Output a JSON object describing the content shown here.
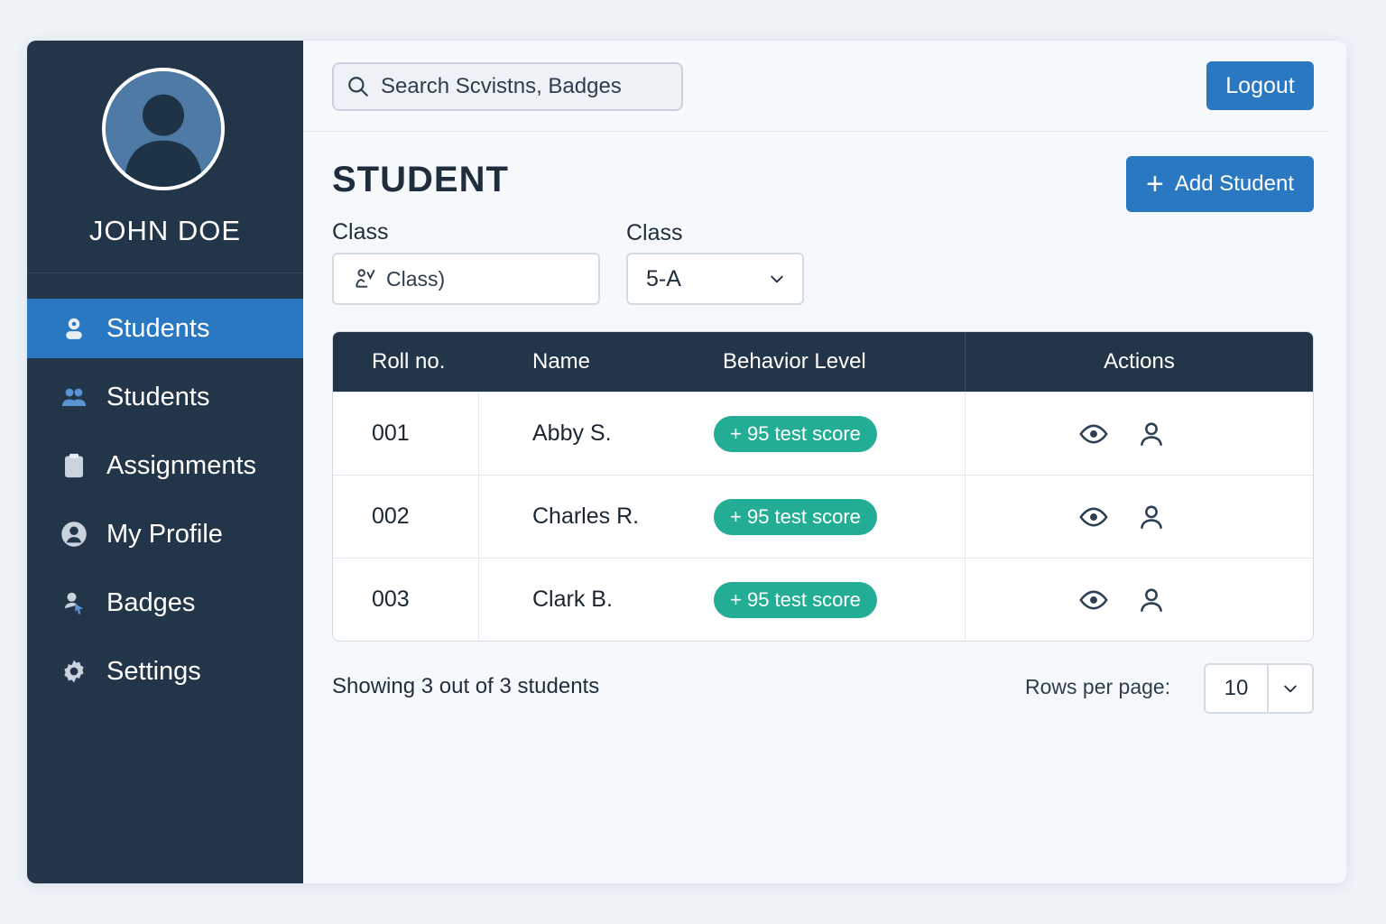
{
  "sidebar": {
    "user_name": "JOHN DOE",
    "items": [
      {
        "label": "Students",
        "icon": "student-icon",
        "active": true
      },
      {
        "label": "Students",
        "icon": "users-icon",
        "active": false
      },
      {
        "label": "Assignments",
        "icon": "clipboard-icon",
        "active": false
      },
      {
        "label": "My Profile",
        "icon": "profile-icon",
        "active": false
      },
      {
        "label": "Badges",
        "icon": "badge-icon",
        "active": false
      },
      {
        "label": "Settings",
        "icon": "gear-icon",
        "active": false
      }
    ]
  },
  "header": {
    "search_placeholder": "Search Scvistns, Badges",
    "logout_label": "Logout"
  },
  "page": {
    "title": "STUDENT",
    "add_button_label": "Add Student",
    "filter1_label": "Class",
    "filter1_value": "Class)",
    "filter2_label": "Class",
    "filter2_value": "5-A"
  },
  "table": {
    "headers": [
      "Roll no.",
      "Name",
      "Behavior Level",
      "Actions"
    ],
    "rows": [
      {
        "roll": "001",
        "name": "Abby S.",
        "behavior": "+ 95 test score"
      },
      {
        "roll": "002",
        "name": "Charles R.",
        "behavior": "+ 95 test score"
      },
      {
        "roll": "003",
        "name": "Clark B.",
        "behavior": "+ 95 test score"
      }
    ]
  },
  "footer": {
    "showing_text": "Showing 3 out of 3 students",
    "rows_per_page_label": "Rows per page:",
    "rows_per_page_value": "10"
  },
  "colors": {
    "sidebar_bg": "#233649",
    "accent": "#2b78c2",
    "badge": "#23ad94"
  }
}
